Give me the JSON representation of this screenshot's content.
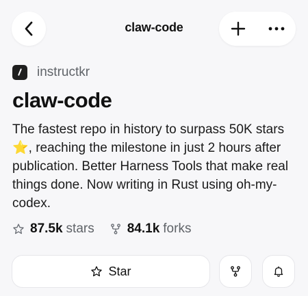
{
  "header": {
    "title": "claw-code",
    "back_icon": "chevron-left-icon",
    "add_icon": "plus-icon",
    "more_icon": "ellipsis-icon"
  },
  "repo": {
    "owner": "instructkr",
    "name": "claw-code",
    "description": "The fastest repo in history to surpass 50K stars ⭐, reaching the milestone in just 2 hours after publication. Better Harness Tools that make real things done. Now writing in Rust using oh-my-codex."
  },
  "stats": {
    "stars_count": "87.5k",
    "stars_label": "stars",
    "forks_count": "84.1k",
    "forks_label": "forks"
  },
  "buttons": {
    "star_label": "Star",
    "fork_icon": "fork-icon",
    "notify_icon": "bell-icon"
  }
}
